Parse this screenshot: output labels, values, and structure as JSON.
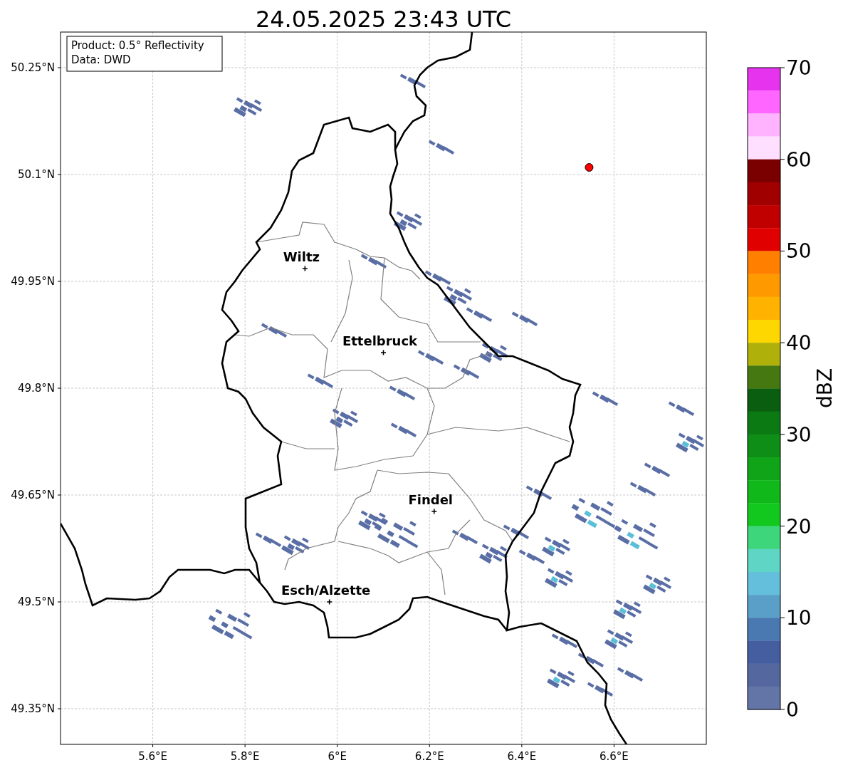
{
  "figure": {
    "title": "24.05.2025 23:43 UTC",
    "info_box": {
      "lines": [
        "Product: 0.5° Reflectivity",
        "Data: DWD"
      ]
    },
    "map": {
      "x_tick_labels": [
        "5.6°E",
        "5.8°E",
        "6°E",
        "6.2°E",
        "6.4°E",
        "6.6°E"
      ],
      "y_tick_labels": [
        "50.25°N",
        "50.1°N",
        "49.95°N",
        "49.8°N",
        "49.65°N",
        "49.5°N",
        "49.35°N"
      ],
      "cities": [
        {
          "name": "Wiltz"
        },
        {
          "name": "Ettelbruck"
        },
        {
          "name": "Findel"
        },
        {
          "name": "Esch/Alzette"
        }
      ],
      "marker": {
        "color": "#ff0000"
      }
    },
    "colorbar": {
      "label": "dBZ",
      "ticks": [
        "70",
        "60",
        "50",
        "40",
        "30",
        "20",
        "10",
        "0"
      ],
      "bins": [
        {
          "color": "#e633ee"
        },
        {
          "color": "#ff66ff"
        },
        {
          "color": "#ffb3ff"
        },
        {
          "color": "#ffdfff"
        },
        {
          "color": "#7a0000"
        },
        {
          "color": "#a00000"
        },
        {
          "color": "#c00000"
        },
        {
          "color": "#e00000"
        },
        {
          "color": "#ff7f00"
        },
        {
          "color": "#ff9900"
        },
        {
          "color": "#ffb300"
        },
        {
          "color": "#ffd700"
        },
        {
          "color": "#b0b00a"
        },
        {
          "color": "#457810"
        },
        {
          "color": "#0a5e0f"
        },
        {
          "color": "#0b7a12"
        },
        {
          "color": "#0e8e16"
        },
        {
          "color": "#10a418"
        },
        {
          "color": "#10b81a"
        },
        {
          "color": "#12c81e"
        },
        {
          "color": "#3ed67a"
        },
        {
          "color": "#5fd6c5"
        },
        {
          "color": "#64bfdd"
        },
        {
          "color": "#5a9fc8"
        },
        {
          "color": "#4a79b1"
        },
        {
          "color": "#455e9f"
        },
        {
          "color": "#55679f"
        },
        {
          "color": "#6375a6"
        }
      ]
    }
  }
}
